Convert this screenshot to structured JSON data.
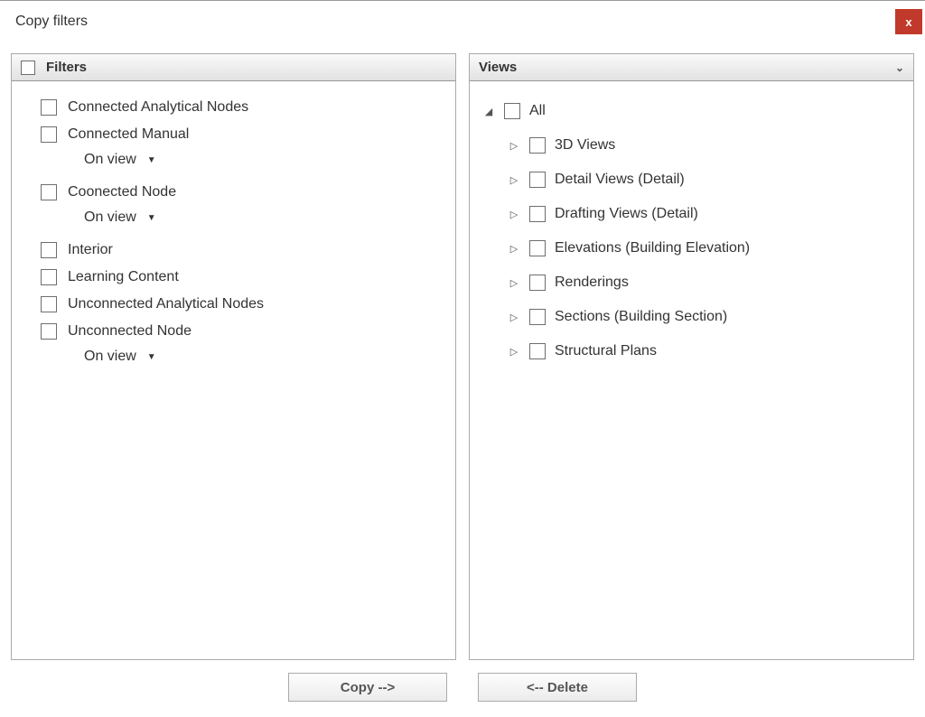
{
  "window": {
    "title": "Copy filters",
    "close_glyph": "x"
  },
  "filters": {
    "header": "Filters",
    "on_view_label": "On view",
    "items": [
      {
        "label": "Connected Analytical Nodes",
        "has_sub": false
      },
      {
        "label": "Connected Manual",
        "has_sub": true
      },
      {
        "label": "Coonected Node",
        "has_sub": true
      },
      {
        "label": "Interior",
        "has_sub": false
      },
      {
        "label": "Learning Content",
        "has_sub": false
      },
      {
        "label": "Unconnected Analytical Nodes",
        "has_sub": false
      },
      {
        "label": "Unconnected Node",
        "has_sub": true
      }
    ]
  },
  "views": {
    "header": "Views",
    "root_label": "All",
    "children": [
      "3D Views",
      "Detail Views (Detail)",
      "Drafting Views (Detail)",
      "Elevations (Building Elevation)",
      "Renderings",
      "Sections (Building Section)",
      "Structural Plans"
    ]
  },
  "buttons": {
    "copy": "Copy -->",
    "delete": "<-- Delete"
  }
}
